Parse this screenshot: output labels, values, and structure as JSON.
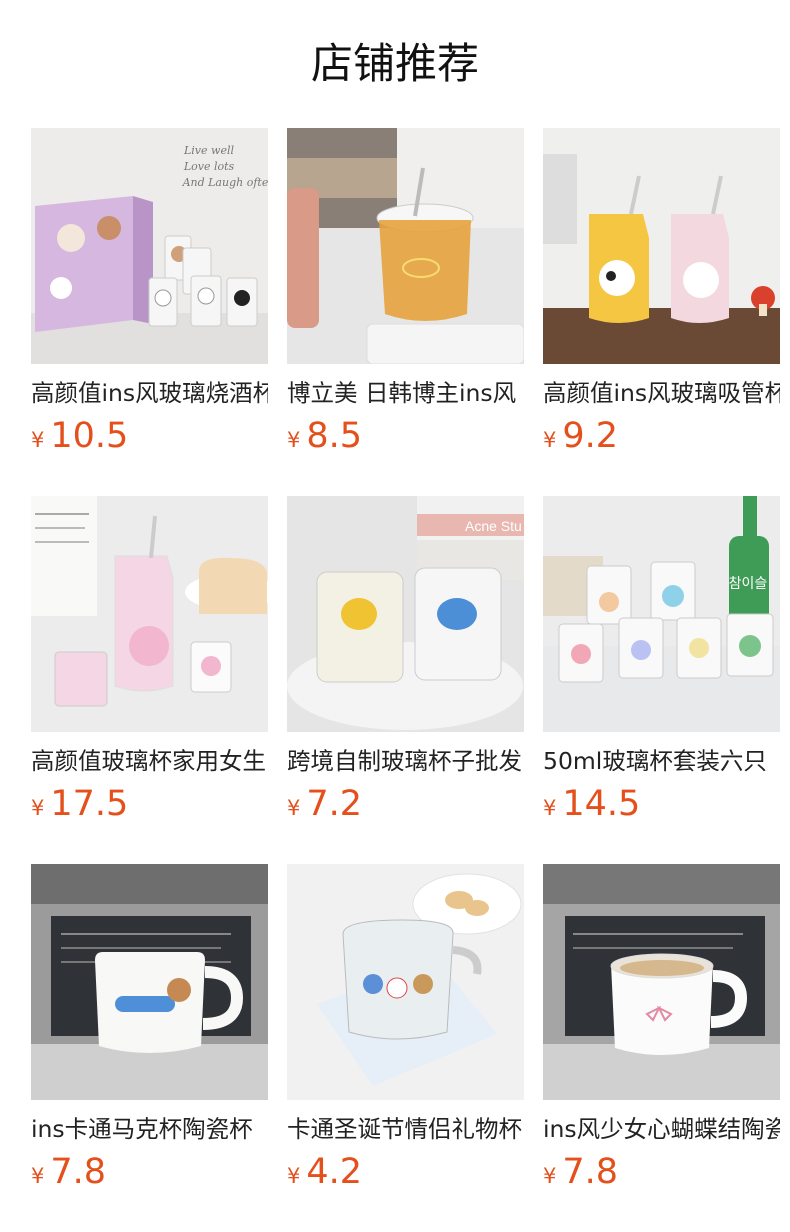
{
  "section_title": "店铺推荐",
  "currency_symbol": "¥",
  "accent_color": "#e4501b",
  "products": [
    {
      "name": "高颜值ins风玻璃烧酒杯",
      "price": "10.5"
    },
    {
      "name": "博立美 日韩博主ins风",
      "price": "8.5"
    },
    {
      "name": "高颜值ins风玻璃吸管杯",
      "price": "9.2"
    },
    {
      "name": "高颜值玻璃杯家用女生",
      "price": "17.5"
    },
    {
      "name": "跨境自制玻璃杯子批发",
      "price": "7.2"
    },
    {
      "name": "50ml玻璃杯套装六只",
      "price": "14.5"
    },
    {
      "name": "ins卡通马克杯陶瓷杯",
      "price": "7.8"
    },
    {
      "name": "卡通圣诞节情侣礼物杯",
      "price": "4.2"
    },
    {
      "name": "ins风少女心蝴蝶结陶瓷",
      "price": "7.8"
    }
  ],
  "image_text": {
    "card1": [
      "Live well",
      "Love lots",
      "And Laugh often"
    ],
    "card5": [
      "Acne Stu"
    ],
    "card6": [
      "참이슬"
    ]
  }
}
